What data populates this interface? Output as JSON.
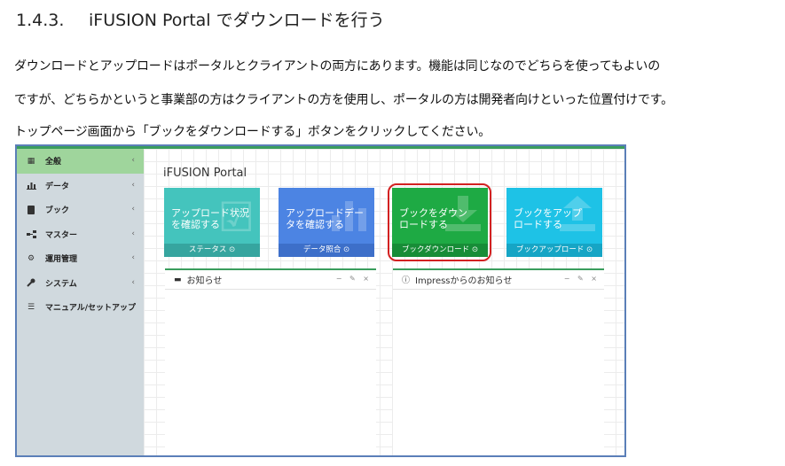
{
  "heading": {
    "number": "1.4.3.",
    "title": "iFUSION Portal でダウンロードを行う"
  },
  "paragraphs": [
    "ダウンロードとアップロードはポータルとクライアントの両方にあります。機能は同じなのでどちらを使ってもよいの",
    "ですが、どちらかというと事業部の方はクライアントの方を使用し、ポータルの方は開発者向けといった位置付けです。",
    "トップページ画面から「ブックをダウンロードする」ボタンをクリックしてください。"
  ],
  "screenshot": {
    "sidebar": {
      "items": [
        {
          "label": "全般",
          "icon": "grid-icon",
          "chevron": "‹"
        },
        {
          "label": "データ",
          "icon": "bar-chart-icon",
          "chevron": "‹"
        },
        {
          "label": "ブック",
          "icon": "book-icon",
          "chevron": "‹"
        },
        {
          "label": "マスター",
          "icon": "sitemap-icon",
          "chevron": "‹"
        },
        {
          "label": "運用管理",
          "icon": "cogs-icon",
          "chevron": "‹"
        },
        {
          "label": "システム",
          "icon": "wrench-icon",
          "chevron": "‹"
        },
        {
          "label": "マニュアル/セットアップ",
          "icon": "list-icon",
          "chevron": ""
        }
      ]
    },
    "portal_title": "iFUSION Portal",
    "tiles": [
      {
        "label_1": "アップロード状況",
        "label_2": "を確認する",
        "footer": "ステータス ⊙",
        "color": "#44c4bd"
      },
      {
        "label_1": "アップロードデー",
        "label_2": "タを確認する",
        "footer": "データ照合 ⊙",
        "color": "#4c84e3"
      },
      {
        "label_1": "ブックをダウン",
        "label_2": "ロードする",
        "footer": "ブックダウンロード ⊙",
        "color": "#1eaa44"
      },
      {
        "label_1": "ブックをアップ",
        "label_2": "ロードする",
        "footer": "ブックアップロード ⊙",
        "color": "#1ec2e6"
      }
    ],
    "panels": [
      {
        "title": "お知らせ",
        "icon": "comment-icon",
        "controls": "− ✎ ×"
      },
      {
        "title": "Impressからのお知らせ",
        "icon": "info-icon",
        "controls": "− ✎ ×"
      }
    ],
    "highlight_color": "#d32121"
  }
}
